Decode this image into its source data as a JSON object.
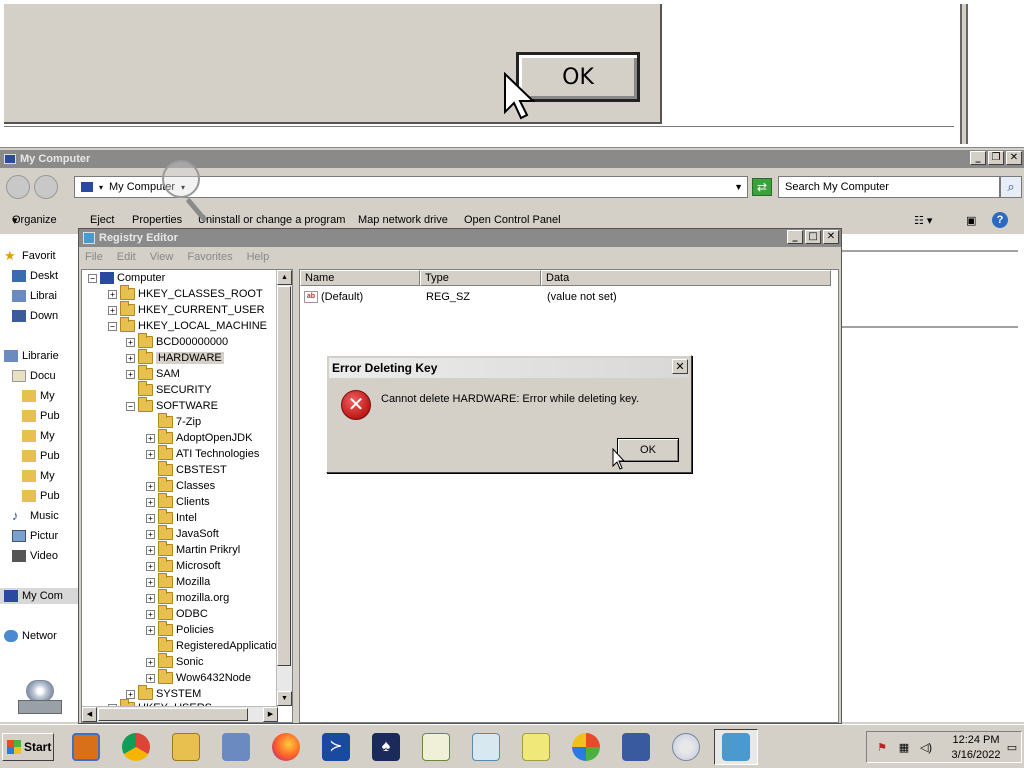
{
  "zoom": {
    "ok_label": "OK"
  },
  "explorer": {
    "title": "My Computer",
    "address": "My Computer",
    "search_placeholder": "Search My Computer",
    "commands": [
      "Organize",
      "Eject",
      "Properties",
      "Uninstall or change a program",
      "Map network drive",
      "Open Control Panel"
    ],
    "nav": {
      "favorites": "Favorit",
      "desktop": "Deskt",
      "libraries_short": "Librai",
      "downloads": "Down",
      "libraries": "Librarie",
      "documents": "Docu",
      "my1": "My",
      "pub1": "Pub",
      "my2": "My",
      "pub2": "Pub",
      "my3": "My",
      "pub3": "Pub",
      "music": "Music",
      "pictures": "Pictur",
      "videos": "Video",
      "my_computer": "My Com",
      "network": "Networ"
    }
  },
  "regedit": {
    "title": "Registry Editor",
    "menu": [
      "File",
      "Edit",
      "View",
      "Favorites",
      "Help"
    ],
    "tree": {
      "computer": "Computer",
      "hkcr": "HKEY_CLASSES_ROOT",
      "hkcu": "HKEY_CURRENT_USER",
      "hklm": "HKEY_LOCAL_MACHINE",
      "bcd": "BCD00000000",
      "hardware": "HARDWARE",
      "sam": "SAM",
      "security": "SECURITY",
      "software": "SOFTWARE",
      "software_children": [
        "7-Zip",
        "AdoptOpenJDK",
        "ATI Technologies",
        "CBSTEST",
        "Classes",
        "Clients",
        "Intel",
        "JavaSoft",
        "Martin Prikryl",
        "Microsoft",
        "Mozilla",
        "mozilla.org",
        "ODBC",
        "Policies",
        "RegisteredApplicatio",
        "Sonic",
        "Wow6432Node"
      ],
      "system": "SYSTEM",
      "hku": "HKEY_USERS"
    },
    "columns": {
      "name": "Name",
      "type": "Type",
      "data": "Data"
    },
    "rows": [
      {
        "name": "(Default)",
        "type": "REG_SZ",
        "data": "(value not set)"
      }
    ]
  },
  "error_dialog": {
    "title": "Error Deleting Key",
    "message": "Cannot delete HARDWARE:  Error while deleting key.",
    "ok_label": "OK",
    "close_label": "✕"
  },
  "taskbar": {
    "start_label": "Start",
    "time": "12:24 PM",
    "date": "3/16/2022"
  }
}
